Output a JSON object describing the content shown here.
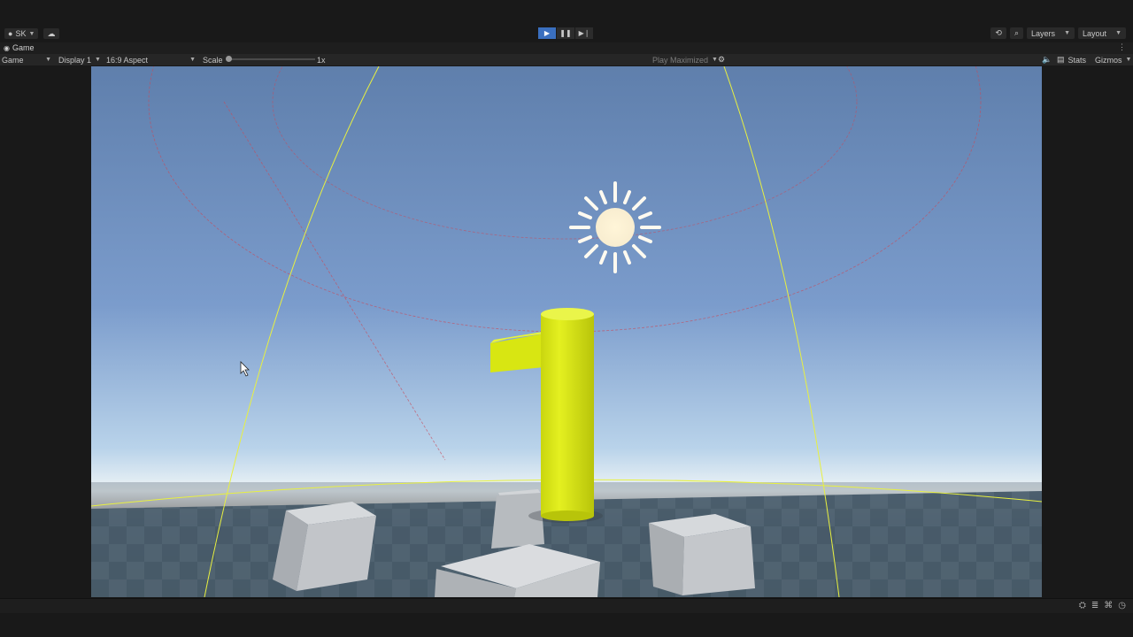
{
  "topbar": {
    "account_label": "SK",
    "cloud_icon": "cloud-icon",
    "play_icon": "play-icon",
    "pause_icon": "pause-icon",
    "step_icon": "step-icon",
    "history_icon": "history-icon",
    "search_icon": "search-icon",
    "layers_label": "Layers",
    "layout_label": "Layout"
  },
  "tab": {
    "label": "Game"
  },
  "toolbar": {
    "mode_label": "Game",
    "display_label": "Display 1",
    "aspect_label": "16:9 Aspect",
    "scale_label": "Scale",
    "scale_value_label": "1x",
    "scale_value": 0,
    "play_maximized_label": "Play Maximized",
    "stats_label": "Stats",
    "gizmos_label": "Gizmos"
  },
  "colors": {
    "accent": "#3a6fbf",
    "gizmo_yellow": "#e8f040",
    "gizmo_red": "#c84a5a",
    "object_yellow": "#d8e612"
  }
}
